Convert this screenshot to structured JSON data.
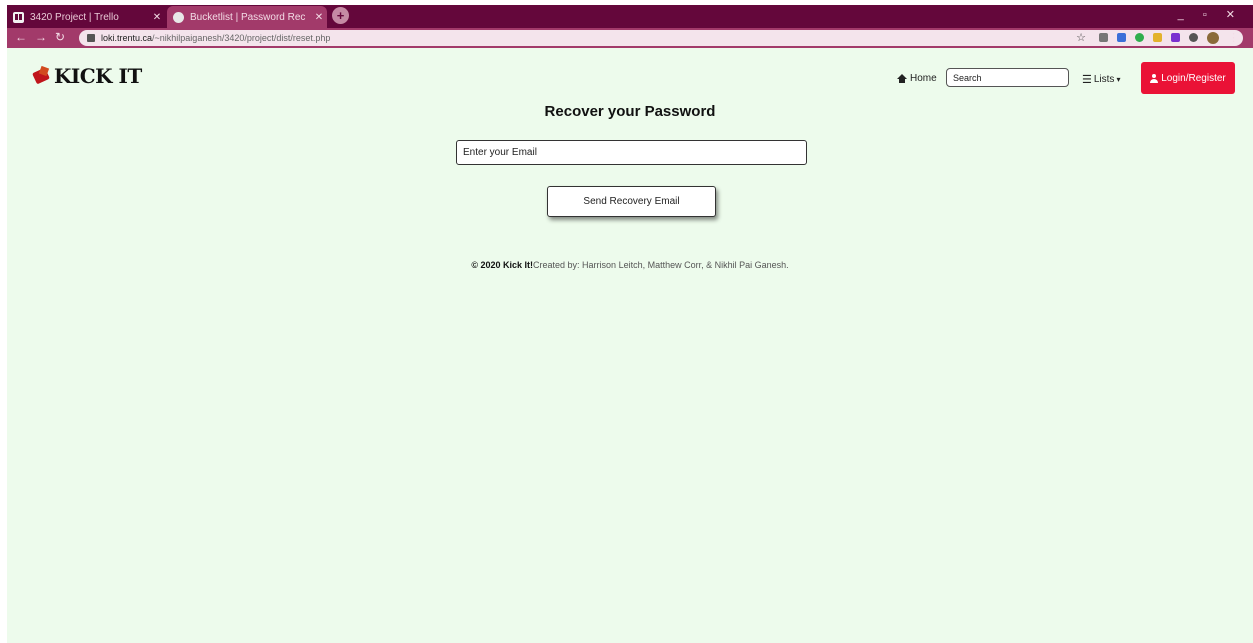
{
  "browser": {
    "tabs": [
      {
        "title": "3420 Project | Trello"
      },
      {
        "title": "Bucketlist | Password Rec"
      }
    ],
    "url_host": "loki.trentu.ca",
    "url_path": "/~nikhilpaiganesh/3420/project/dist/reset.php"
  },
  "site": {
    "logo_text": "KICK IT",
    "nav": {
      "home_label": "Home",
      "search_placeholder": "Search",
      "lists_label": "Lists",
      "login_label": "Login/Register"
    }
  },
  "main": {
    "heading": "Recover your Password",
    "email_placeholder": "Enter your Email",
    "send_button_label": "Send Recovery Email"
  },
  "footer": {
    "brand": "© 2020 Kick It!",
    "credits": "Created by: Harrison Leitch, Matthew Corr, & Nikhil Pai Ganesh."
  },
  "colors": {
    "page_bg": "#edfbec",
    "accent": "#ea1236",
    "browser_frame": "#64073b"
  }
}
